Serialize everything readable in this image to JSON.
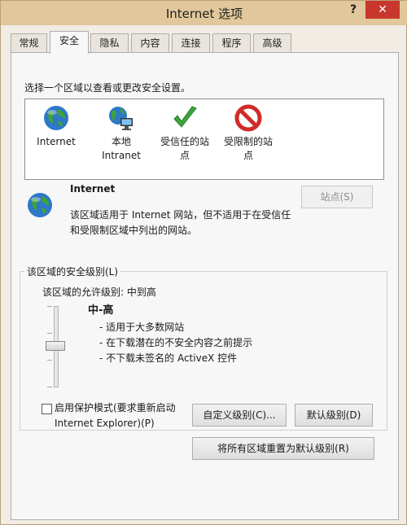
{
  "window": {
    "title": "Internet 选项",
    "help": "?",
    "close": "✕"
  },
  "tabs": [
    {
      "label": "常规"
    },
    {
      "label": "安全",
      "active": true
    },
    {
      "label": "隐私"
    },
    {
      "label": "内容"
    },
    {
      "label": "连接"
    },
    {
      "label": "程序"
    },
    {
      "label": "高级"
    }
  ],
  "security": {
    "zone_caption": "选择一个区域以查看或更改安全设置。",
    "zones": [
      {
        "line1": "Internet",
        "line2": "",
        "icon": "globe-icon"
      },
      {
        "line1": "本地",
        "line2": "Intranet",
        "icon": "intranet-icon"
      },
      {
        "line1": "受信任的站",
        "line2": "点",
        "icon": "checkmark-icon"
      },
      {
        "line1": "受限制的站",
        "line2": "点",
        "icon": "restricted-icon"
      }
    ],
    "selected_zone": {
      "title": "Internet",
      "desc_line1": "该区域适用于 Internet 网站，但不适用于在受信任",
      "desc_line2": "和受限制区域中列出的网站。",
      "sites_button": "站点(S)"
    },
    "level": {
      "legend": "该区域的安全级别(L)",
      "allowed": "该区域的允许级别: 中到高",
      "name": "中-高",
      "bullets": [
        "- 适用于大多数网站",
        "- 在下载潜在的不安全内容之前提示",
        "- 不下载未签名的 ActiveX 控件"
      ],
      "protected_mode_line1": "启用保护模式(要求重新启动",
      "protected_mode_line2": "Internet Explorer)(P)",
      "custom_button": "自定义级别(C)...",
      "default_button": "默认级别(D)"
    },
    "reset_button": "将所有区域重置为默认级别(R)"
  },
  "colors": {
    "titlebar": "#e1c79b",
    "close": "#c8372d",
    "check_green": "#3aa63a",
    "restricted_red": "#d12a2a"
  }
}
